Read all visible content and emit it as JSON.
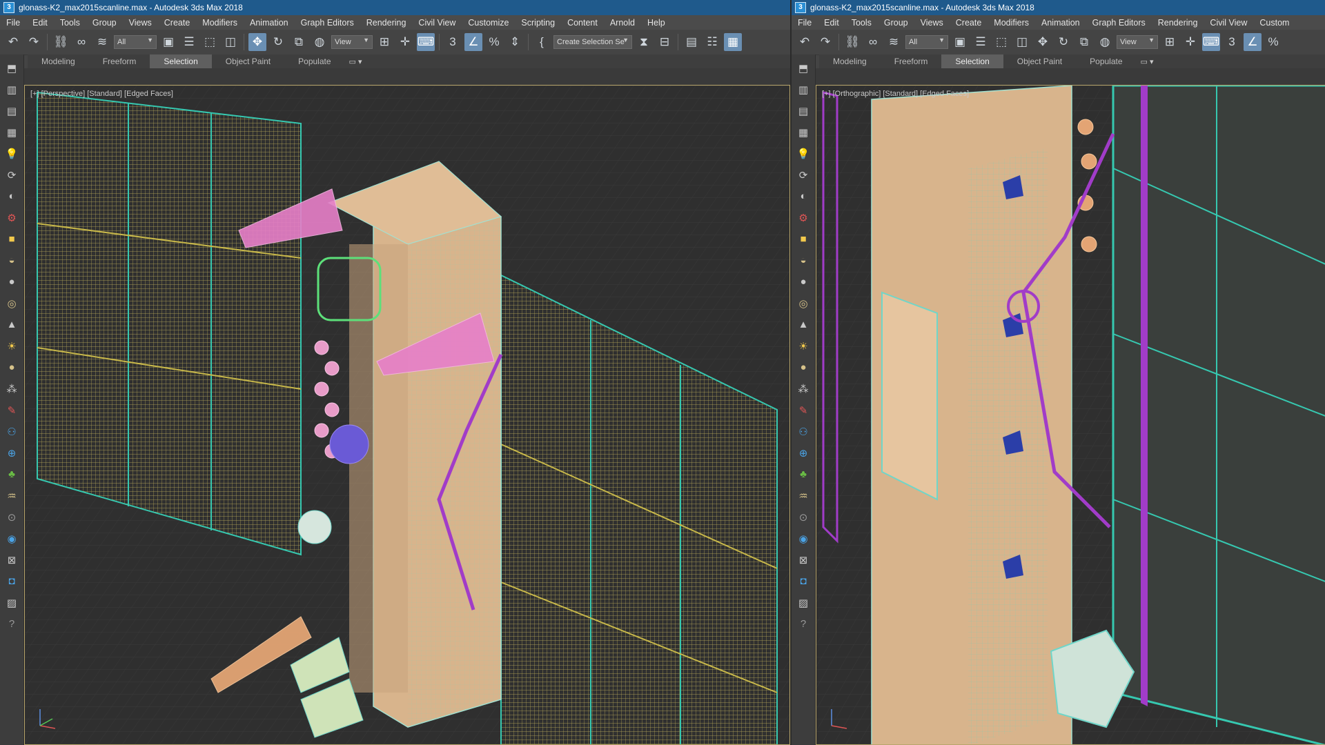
{
  "left_window": {
    "title": "glonass-K2_max2015scanline.max - Autodesk 3ds Max 2018",
    "menu": [
      "File",
      "Edit",
      "Tools",
      "Group",
      "Views",
      "Create",
      "Modifiers",
      "Animation",
      "Graph Editors",
      "Rendering",
      "Civil View",
      "Customize",
      "Scripting",
      "Content",
      "Arnold",
      "Help"
    ],
    "selection_filter": "All",
    "reference_coord": "View",
    "named_selection_placeholder": "Create Selection Se",
    "ribbon_tabs": [
      "Modeling",
      "Freeform",
      "Selection",
      "Object Paint",
      "Populate"
    ],
    "active_ribbon_tab": "Selection",
    "viewport_label": "[+] [Perspective] [Standard] [Edged Faces]"
  },
  "right_window": {
    "title": "glonass-K2_max2015scanline.max - Autodesk 3ds Max 2018",
    "menu": [
      "File",
      "Edit",
      "Tools",
      "Group",
      "Views",
      "Create",
      "Modifiers",
      "Animation",
      "Graph Editors",
      "Rendering",
      "Civil View",
      "Custom"
    ],
    "selection_filter": "All",
    "reference_coord": "View",
    "ribbon_tabs": [
      "Modeling",
      "Freeform",
      "Selection",
      "Object Paint",
      "Populate"
    ],
    "active_ribbon_tab": "Selection",
    "viewport_label": "[+] [Orthographic] [Standard] [Edged Faces]"
  },
  "icons": {
    "toolbar": [
      "undo-icon",
      "redo-icon",
      "select-and-link-icon",
      "unlink-icon",
      "bind-space-warp-icon",
      "select-object-icon",
      "select-by-name-icon",
      "rectangular-selection-icon",
      "window-crossing-icon",
      "move-icon",
      "rotate-icon",
      "scale-icon",
      "select-place-icon",
      "use-pivot-icon",
      "select-manipulate-icon",
      "keyboard-shortcut-icon",
      "snaps-toggle-icon",
      "angle-snap-icon",
      "percent-snap-icon",
      "spinner-snap-icon",
      "edit-named-selection-icon",
      "mirror-icon",
      "align-icon",
      "scene-explorer-icon",
      "layer-explorer-icon",
      "ribbon-toggle-icon"
    ],
    "sidebar": [
      "viewport-layouts-icon",
      "render-setup-icon",
      "rendered-frame-icon",
      "material-editor-icon",
      "light-icon",
      "camera-orbit-icon",
      "camera-dolly-icon",
      "camera-pan-icon",
      "box-icon",
      "sphere-icon",
      "cylinder-icon",
      "torus-icon",
      "cone-icon",
      "sun-icon",
      "geosphere-icon",
      "particle-icon",
      "bone-icon",
      "biped-icon",
      "globe-icon",
      "foliage-icon",
      "hair-icon",
      "nitrous-icon",
      "sphere-gizmo-icon",
      "container-icon",
      "arnold-icon",
      "layers-icon",
      "help-icon"
    ]
  },
  "colors": {
    "title_bar": "#1f5a8c",
    "viewport_bg": "#2f2f2f",
    "viewport_border": "#b8a56a",
    "active_tab": "#5f5f5f",
    "wire_teal": "#36c8b0",
    "wire_yellow": "#c8b84a",
    "wire_pink": "#e77fc9",
    "body_tan": "#d8b48c",
    "cable_purple": "#a13cc8"
  }
}
